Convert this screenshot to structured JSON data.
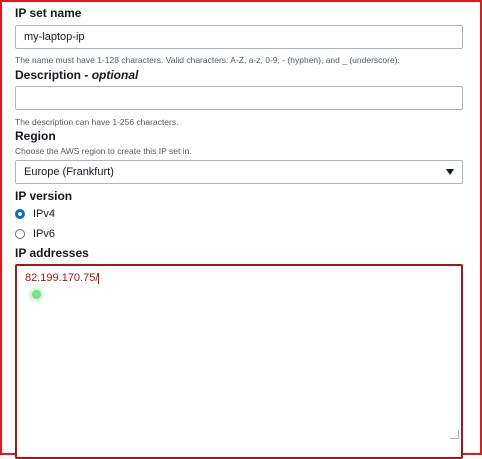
{
  "ip_set_name": {
    "label": "IP set name",
    "value": "my-laptop-ip",
    "hint": "The name must have 1-128 characters. Valid characters: A-Z, a-z, 0-9, - (hyphen), and _ (underscore)."
  },
  "description": {
    "label": "Description",
    "optional": "optional",
    "value": "",
    "hint": "The description can have 1-256 characters."
  },
  "region": {
    "label": "Region",
    "hint": "Choose the AWS region to create this IP set in.",
    "selected": "Europe (Frankfurt)"
  },
  "ip_version": {
    "label": "IP version",
    "options": [
      {
        "label": "IPv4",
        "checked": true
      },
      {
        "label": "IPv6",
        "checked": false
      }
    ]
  },
  "ip_addresses": {
    "label": "IP addresses",
    "value": "82.199.170.75/"
  },
  "colors": {
    "accent": "#0073bb",
    "frame": "#e0191b",
    "textarea_border": "#a4161a"
  }
}
